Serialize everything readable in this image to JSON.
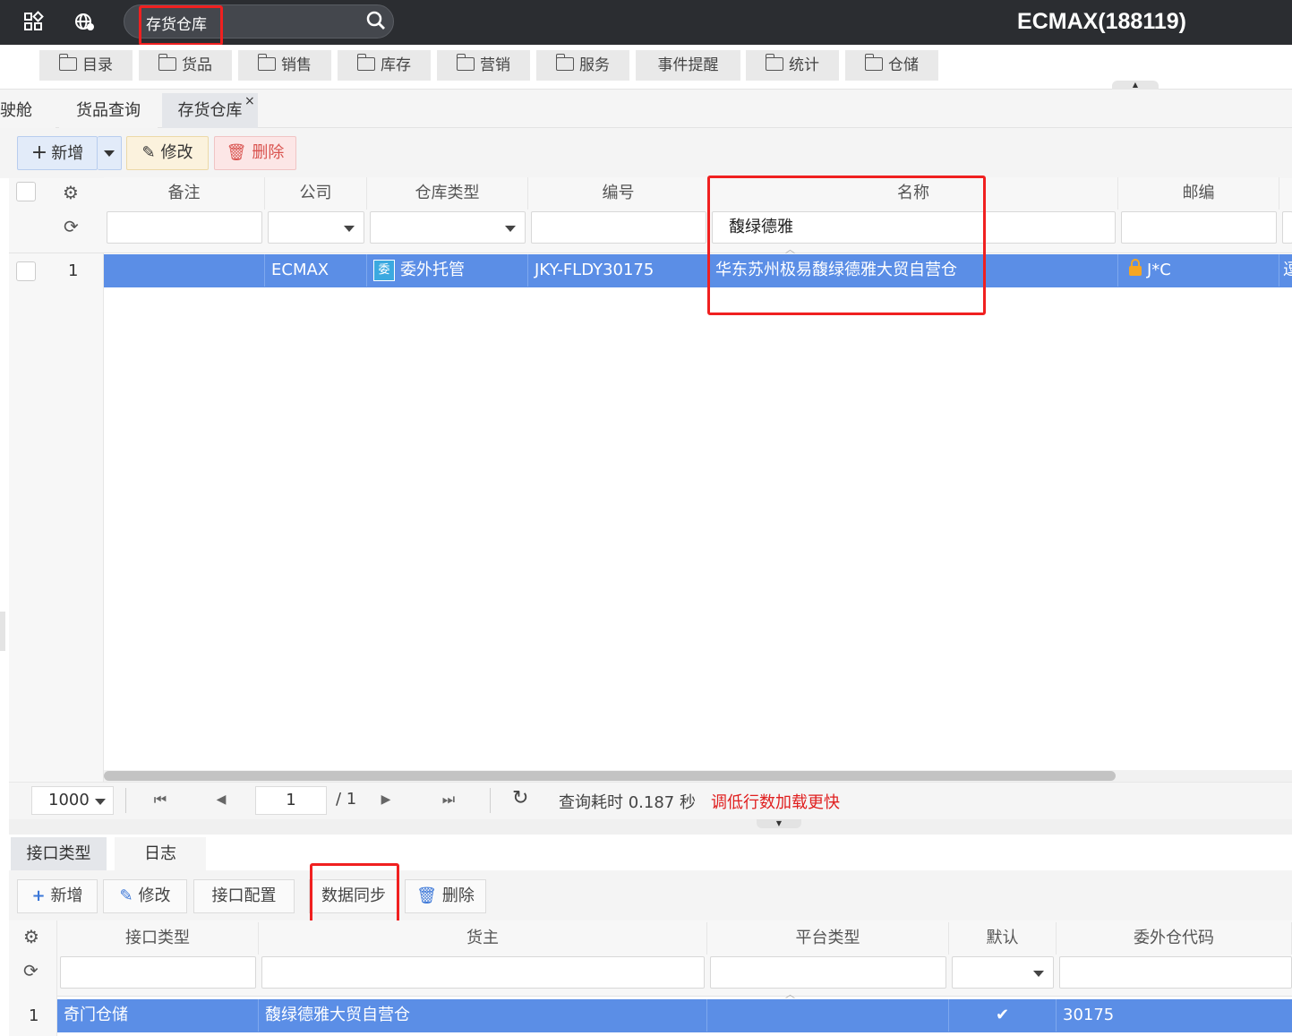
{
  "topbar": {
    "search_value": "存货仓库",
    "brand": "ECMAX(188119)"
  },
  "menu": [
    {
      "label": "目录",
      "icon": "folder-icon"
    },
    {
      "label": "货品",
      "icon": "folder-icon"
    },
    {
      "label": "销售",
      "icon": "folder-icon"
    },
    {
      "label": "库存",
      "icon": "folder-icon"
    },
    {
      "label": "营销",
      "icon": "folder-icon"
    },
    {
      "label": "服务",
      "icon": "folder-icon"
    },
    {
      "label": "事件提醒",
      "icon": ""
    },
    {
      "label": "统计",
      "icon": "folder-icon"
    },
    {
      "label": "仓储",
      "icon": "folder-icon"
    }
  ],
  "page_tabs": [
    {
      "label": "驶舱"
    },
    {
      "label": "货品查询"
    },
    {
      "label": "存货仓库",
      "active": true,
      "close": "×"
    }
  ],
  "toolbar": {
    "add": "新增",
    "edit": "修改",
    "delete": "删除"
  },
  "grid": {
    "columns": [
      "备注",
      "公司",
      "仓库类型",
      "编号",
      "名称",
      "邮编"
    ],
    "filter_name_value": "馥绿德雅",
    "rows": [
      {
        "index": "1",
        "remark": "",
        "company": "ECMAX",
        "type_badge": "委",
        "type": "委外托管",
        "code": "JKY-FLDY30175",
        "name": "华东苏州极易馥绿德雅大贸自营仓",
        "zip": "J*C",
        "extra": "逗"
      }
    ]
  },
  "pager": {
    "page_size": "1000",
    "page": "1",
    "total_pages": "/ 1",
    "query_time": "查询耗时 0.187 秒",
    "tip": "调低行数加载更快"
  },
  "bottom_tabs": [
    {
      "label": "接口类型",
      "active": true
    },
    {
      "label": "日志"
    }
  ],
  "bottom_toolbar": {
    "add": "新增",
    "edit": "修改",
    "config": "接口配置",
    "sync": "数据同步",
    "delete": "删除"
  },
  "bottom_grid": {
    "columns": [
      "接口类型",
      "货主",
      "平台类型",
      "默认",
      "委外仓代码"
    ],
    "rows": [
      {
        "index": "1",
        "iface_type": "奇门仓储",
        "owner": "馥绿德雅大贸自营仓",
        "platform": "",
        "default": "✔",
        "code": "30175"
      }
    ]
  },
  "colors": {
    "topbar": "#2b2d31",
    "selected_row": "#5b8ee6",
    "highlight_box": "#f02020",
    "tip_text": "#e02020"
  }
}
